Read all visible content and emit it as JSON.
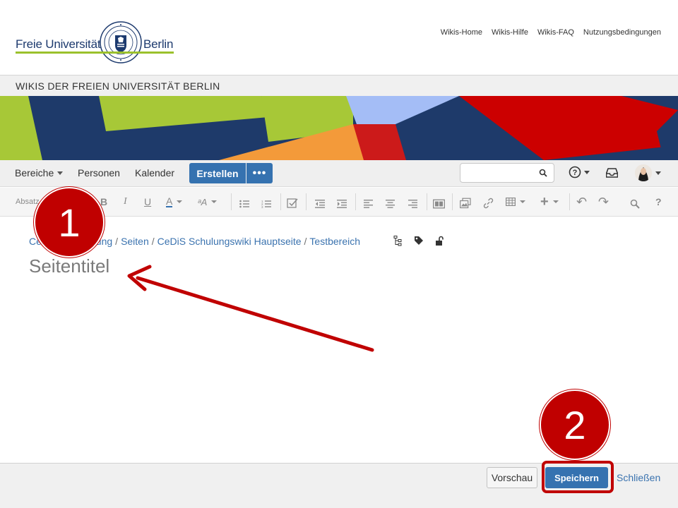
{
  "header": {
    "logo_left": "Freie Universität",
    "logo_right": "Berlin",
    "links": [
      "Wikis-Home",
      "Wikis-Hilfe",
      "Wikis-FAQ",
      "Nutzungsbedingungen"
    ]
  },
  "site_title": "WIKIS DER FREIEN UNIVERSITÄT BERLIN",
  "nav": {
    "spaces": "Bereiche",
    "people": "Personen",
    "calendar": "Kalender",
    "create": "Erstellen",
    "more": "•••",
    "search_value": ""
  },
  "toolbar": {
    "paragraph": "Absatz",
    "icons": [
      "bold-icon",
      "italic-icon",
      "underline-icon",
      "text-color-icon",
      "more-formatting-icon",
      "bullet-list-icon",
      "numbered-list-icon",
      "task-list-icon",
      "outdent-icon",
      "indent-icon",
      "align-left-icon",
      "align-center-icon",
      "align-right-icon",
      "page-layout-icon",
      "insert-image-icon",
      "insert-link-icon",
      "insert-table-icon",
      "insert-more-icon",
      "undo-icon",
      "redo-icon",
      "find-icon",
      "help-icon"
    ]
  },
  "breadcrumb": {
    "items": [
      "CeDiS Schulung",
      "Seiten",
      "CeDiS Schulungswiki Hauptseite",
      "Testbereich"
    ],
    "visible_first": "Ce",
    "visible_first_tail": "ulung"
  },
  "page_title_placeholder": "Seitentitel",
  "annotations": {
    "step1": "1",
    "step2": "2"
  },
  "footer": {
    "preview": "Vorschau",
    "save": "Speichern",
    "close": "Schließen"
  },
  "colors": {
    "primary": "#3572b0",
    "annotation_red": "#c00000",
    "logo_blue": "#1d3a6e",
    "logo_green": "#9bc12c"
  }
}
